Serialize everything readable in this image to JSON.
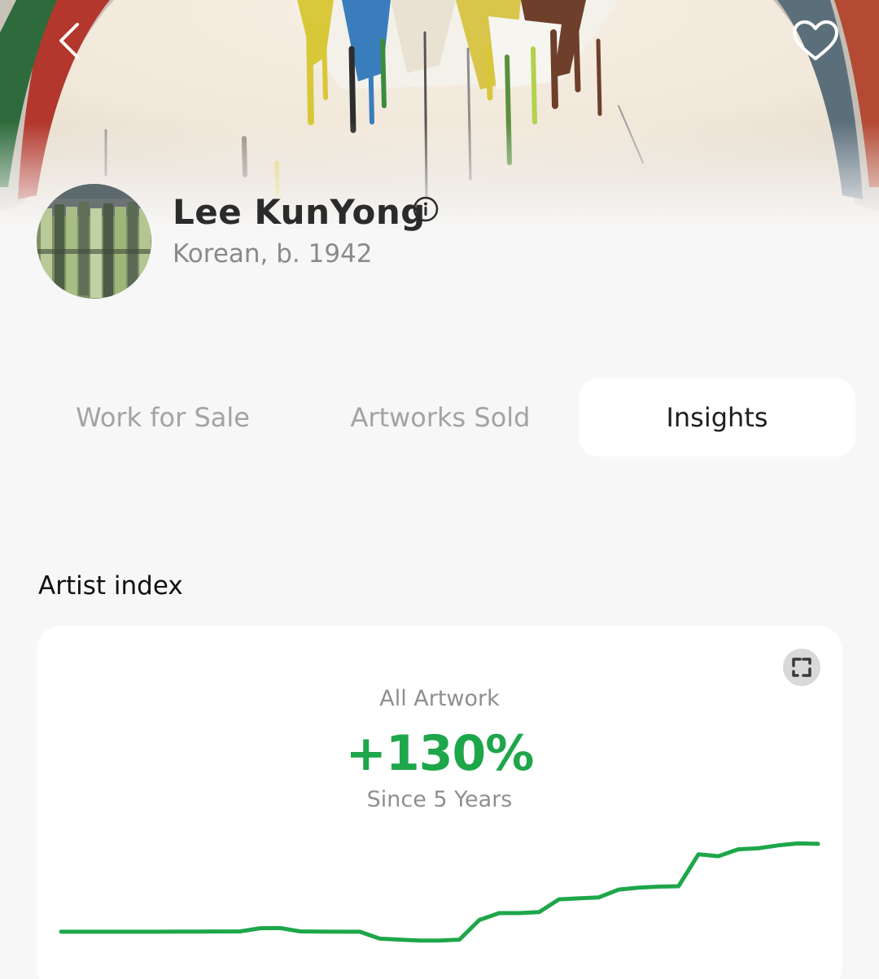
{
  "header": {
    "back_icon": "chevron-left-icon",
    "favorite_icon": "heart-outline-icon"
  },
  "artist": {
    "name": "Lee KunYong",
    "subtitle": "Korean, b. 1942",
    "info_icon": "info-circle-icon"
  },
  "tabs": [
    {
      "label": "Work for Sale",
      "active": false
    },
    {
      "label": "Artworks Sold",
      "active": false
    },
    {
      "label": "Insights",
      "active": true
    }
  ],
  "section": {
    "title": "Artist index"
  },
  "index_card": {
    "category": "All Artwork",
    "change": "+130%",
    "period": "Since 5 Years",
    "expand_icon": "expand-icon",
    "accent_color": "#1ea64a"
  },
  "chart_data": {
    "type": "line",
    "series": [
      {
        "values": [
          0,
          0,
          0,
          0,
          0,
          0,
          0.1,
          0.1,
          0.15,
          0.2,
          1.8,
          1.9,
          0.2,
          0.1,
          0,
          0,
          -3.5,
          -4.0,
          -4.5,
          -4.5,
          -4.0,
          6.0,
          9.5,
          9.5,
          10.0,
          16.5,
          17.0,
          17.5,
          21.5,
          22.5,
          23.0,
          23.2,
          39.5,
          38.5,
          42.0,
          42.5,
          44.0,
          45.0,
          44.8
        ],
        "color": "#1ea64a"
      }
    ]
  }
}
